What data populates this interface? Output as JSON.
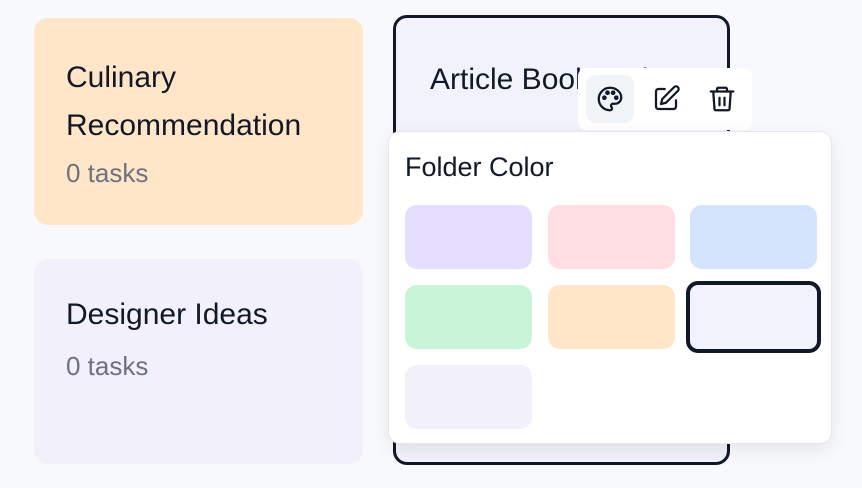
{
  "folders": [
    {
      "title": "Culinary Recommendation",
      "count": "0 tasks",
      "color": "#ffe6c8"
    },
    {
      "title": "Article Bookmark",
      "color": "#f2f2fc"
    },
    {
      "title": "Designer Ideas",
      "count": "0 tasks",
      "color": "#f2f0fb"
    }
  ],
  "toolbar": {
    "icons": [
      "palette-icon",
      "edit-icon",
      "trash-icon"
    ],
    "active": "palette-icon"
  },
  "color_panel": {
    "title": "Folder Color",
    "swatches": [
      {
        "color": "#e5deff",
        "selected": false
      },
      {
        "color": "#ffdfe4",
        "selected": false
      },
      {
        "color": "#d4e4fd",
        "selected": false
      },
      {
        "color": "#c8f4d8",
        "selected": false
      },
      {
        "color": "#ffe6c8",
        "selected": false
      },
      {
        "color": "#f2f2fc",
        "selected": true
      },
      {
        "color": "#f2f0fb",
        "selected": false
      }
    ]
  }
}
